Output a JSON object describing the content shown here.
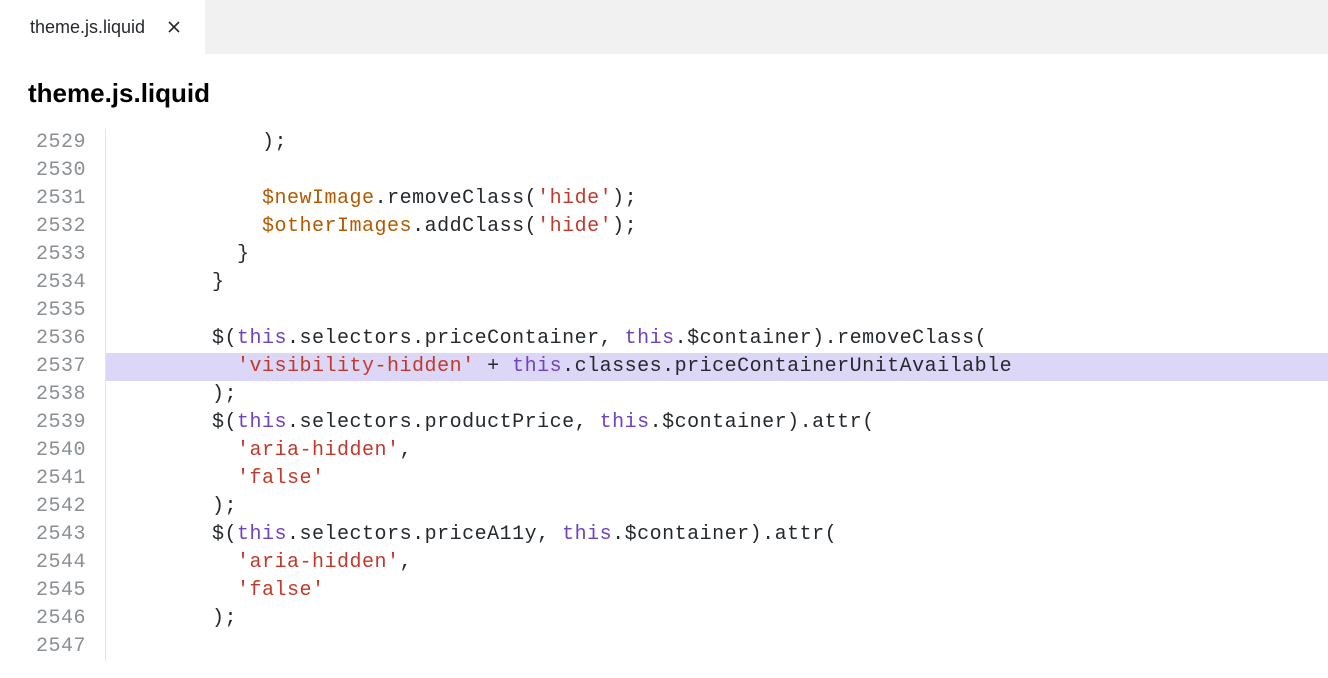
{
  "tab": {
    "label": "theme.js.liquid"
  },
  "header": {
    "filename": "theme.js.liquid"
  },
  "gutter": {
    "start": 2529,
    "lines": [
      "2529",
      "2530",
      "2531",
      "2532",
      "2533",
      "2534",
      "2535",
      "2536",
      "2537",
      "2538",
      "2539",
      "2540",
      "2541",
      "2542",
      "2543",
      "2544",
      "2545",
      "2546",
      "2547"
    ]
  },
  "code": {
    "highlighted_line_index": 8,
    "lines": [
      {
        "indent": "            ",
        "t": [
          {
            "c": "p",
            "s": ");"
          }
        ]
      },
      {
        "indent": "",
        "t": []
      },
      {
        "indent": "            ",
        "t": [
          {
            "c": "var",
            "s": "$newImage"
          },
          {
            "c": "p",
            "s": "."
          },
          {
            "c": "fn",
            "s": "removeClass"
          },
          {
            "c": "p",
            "s": "("
          },
          {
            "c": "str",
            "s": "'hide'"
          },
          {
            "c": "p",
            "s": ");"
          }
        ]
      },
      {
        "indent": "            ",
        "t": [
          {
            "c": "var",
            "s": "$otherImages"
          },
          {
            "c": "p",
            "s": "."
          },
          {
            "c": "fn",
            "s": "addClass"
          },
          {
            "c": "p",
            "s": "("
          },
          {
            "c": "str",
            "s": "'hide'"
          },
          {
            "c": "p",
            "s": ");"
          }
        ]
      },
      {
        "indent": "          ",
        "t": [
          {
            "c": "p",
            "s": "}"
          }
        ]
      },
      {
        "indent": "        ",
        "t": [
          {
            "c": "p",
            "s": "}"
          }
        ]
      },
      {
        "indent": "",
        "t": []
      },
      {
        "indent": "        ",
        "t": [
          {
            "c": "p",
            "s": "$("
          },
          {
            "c": "kw",
            "s": "this"
          },
          {
            "c": "p",
            "s": ".selectors.priceContainer, "
          },
          {
            "c": "kw",
            "s": "this"
          },
          {
            "c": "p",
            "s": ".$container).removeClass("
          }
        ]
      },
      {
        "indent": "          ",
        "t": [
          {
            "c": "str",
            "s": "'visibility-hidden'"
          },
          {
            "c": "p",
            "s": " + "
          },
          {
            "c": "kw",
            "s": "this"
          },
          {
            "c": "p",
            "s": ".classes.priceContainerUnitAvailable"
          }
        ]
      },
      {
        "indent": "        ",
        "t": [
          {
            "c": "p",
            "s": ");"
          }
        ]
      },
      {
        "indent": "        ",
        "t": [
          {
            "c": "p",
            "s": "$("
          },
          {
            "c": "kw",
            "s": "this"
          },
          {
            "c": "p",
            "s": ".selectors.productPrice, "
          },
          {
            "c": "kw",
            "s": "this"
          },
          {
            "c": "p",
            "s": ".$container).attr("
          }
        ]
      },
      {
        "indent": "          ",
        "t": [
          {
            "c": "str",
            "s": "'aria-hidden'"
          },
          {
            "c": "p",
            "s": ","
          }
        ]
      },
      {
        "indent": "          ",
        "t": [
          {
            "c": "str",
            "s": "'false'"
          }
        ]
      },
      {
        "indent": "        ",
        "t": [
          {
            "c": "p",
            "s": ");"
          }
        ]
      },
      {
        "indent": "        ",
        "t": [
          {
            "c": "p",
            "s": "$("
          },
          {
            "c": "kw",
            "s": "this"
          },
          {
            "c": "p",
            "s": ".selectors.priceA11y, "
          },
          {
            "c": "kw",
            "s": "this"
          },
          {
            "c": "p",
            "s": ".$container).attr("
          }
        ]
      },
      {
        "indent": "          ",
        "t": [
          {
            "c": "str",
            "s": "'aria-hidden'"
          },
          {
            "c": "p",
            "s": ","
          }
        ]
      },
      {
        "indent": "          ",
        "t": [
          {
            "c": "str",
            "s": "'false'"
          }
        ]
      },
      {
        "indent": "        ",
        "t": [
          {
            "c": "p",
            "s": ");"
          }
        ]
      },
      {
        "indent": "",
        "t": []
      }
    ]
  }
}
